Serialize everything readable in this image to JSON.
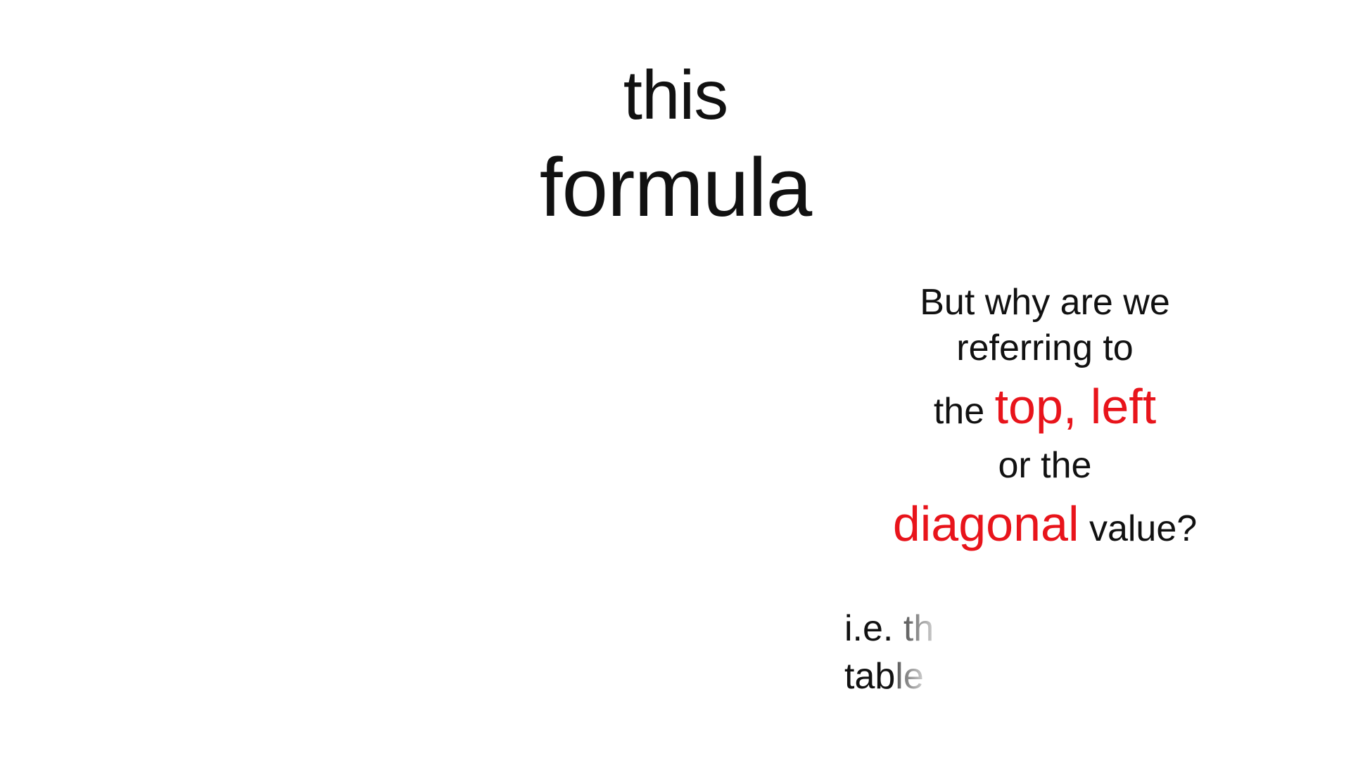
{
  "slide": {
    "title": {
      "line1": "this",
      "line2": "formula"
    },
    "question": {
      "line1": "But why are we",
      "line2": "referring to",
      "line3_prefix": "the",
      "line3_accent": "top, left",
      "line4": "or the",
      "line5_accent": "diagonal",
      "line5_suffix": "value?"
    },
    "followup": {
      "line1_prefix": "i.e.",
      "line1_fade": "th",
      "line2_prefix": "tab",
      "line2_fade": "le"
    },
    "colors": {
      "background": "#ffffff",
      "text": "#111111",
      "accent": "#e8141b"
    }
  }
}
